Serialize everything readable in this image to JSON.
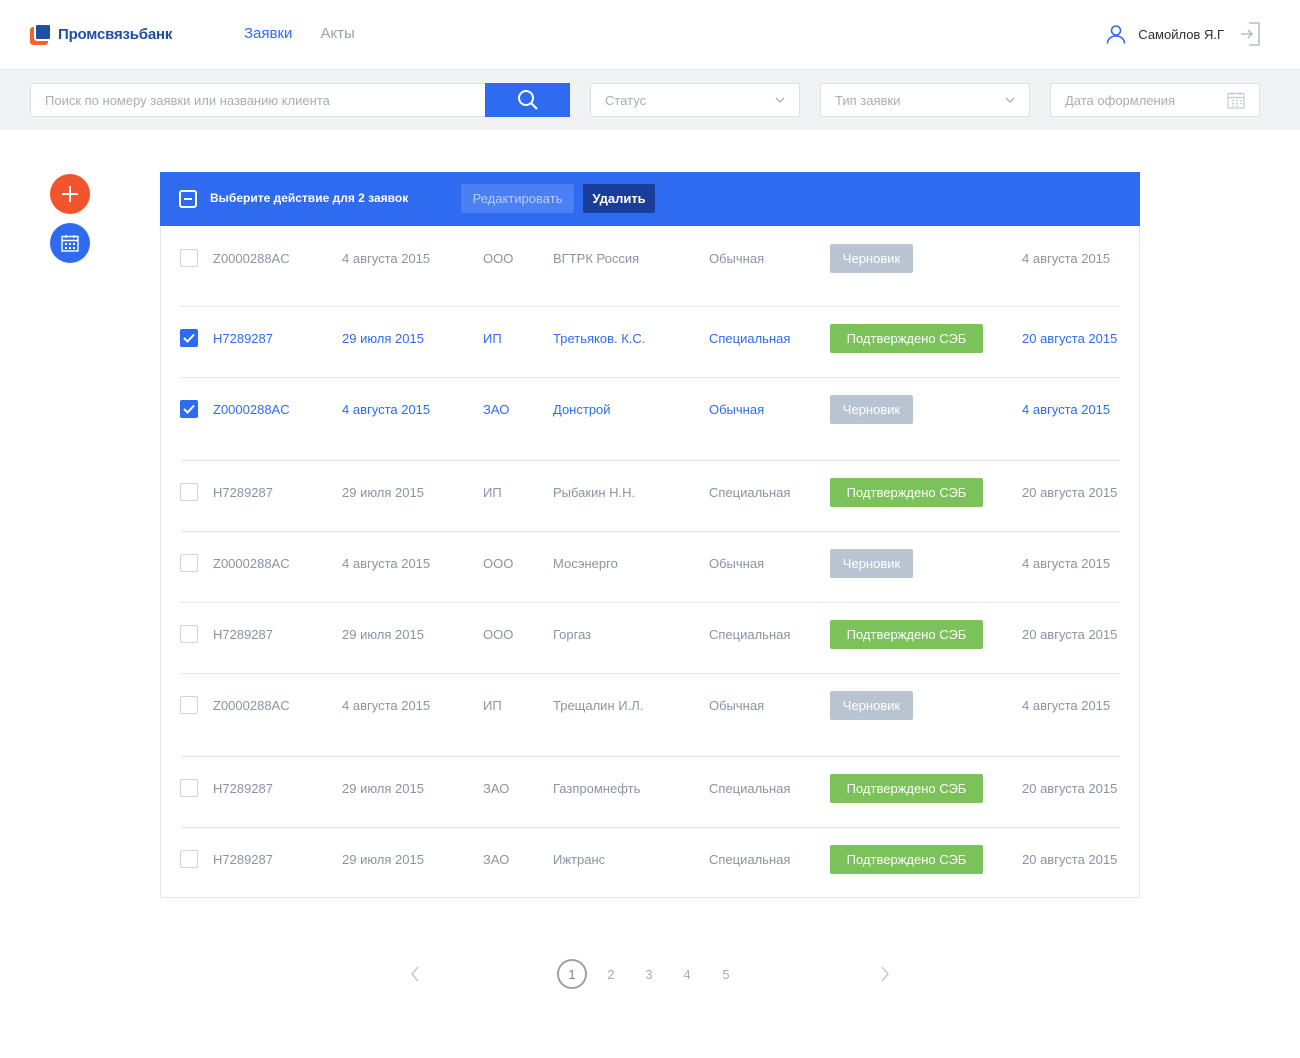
{
  "header": {
    "logo_text": "Промсвязьбанк",
    "nav": [
      {
        "label": "Заявки",
        "active": true
      },
      {
        "label": "Акты",
        "active": false
      }
    ],
    "user_name": "Самойлов Я.Г"
  },
  "filters": {
    "search_placeholder": "Поиск по номеру заявки или названию клиента",
    "status_placeholder": "Статус",
    "type_placeholder": "Тип заявки",
    "date_placeholder": "Дата оформления"
  },
  "action_bar": {
    "text": "Выберите действие для 2 заявок",
    "edit_label": "Редактировать",
    "delete_label": "Удалить"
  },
  "colors": {
    "accent": "#2f6bf0",
    "add_button": "#f2542d",
    "draft_badge": "#b9c4d3",
    "confirmed_badge": "#7bc25a",
    "delete_button": "#1a3d99"
  },
  "rows": [
    {
      "id": "Z0000288AC",
      "date": "4 августа 2015",
      "form": "ООО",
      "client": "ВГТРК Россия",
      "type": "Обычная",
      "status": "Черновик",
      "status_kind": "draft",
      "end_date": "4 августа 2015",
      "selected": false
    },
    {
      "id": "H7289287",
      "date": "29 июля 2015",
      "form": "ИП",
      "client": "Третьяков. К.С.",
      "type": "Специальная",
      "status": "Подтверждено СЭБ",
      "status_kind": "ok",
      "end_date": "20 августа 2015",
      "selected": true
    },
    {
      "id": "Z0000288AC",
      "date": "4 августа 2015",
      "form": "ЗАО",
      "client": "Донстрой",
      "type": "Обычная",
      "status": "Черновик",
      "status_kind": "draft",
      "end_date": "4 августа 2015",
      "selected": true
    },
    {
      "id": "H7289287",
      "date": "29 июля 2015",
      "form": "ИП",
      "client": "Рыбакин Н.Н.",
      "type": "Специальная",
      "status": "Подтверждено СЭБ",
      "status_kind": "ok",
      "end_date": "20 августа 2015",
      "selected": false
    },
    {
      "id": "Z0000288AC",
      "date": "4 августа 2015",
      "form": "ООО",
      "client": "Мосэнерго",
      "type": "Обычная",
      "status": "Черновик",
      "status_kind": "draft",
      "end_date": "4 августа 2015",
      "selected": false
    },
    {
      "id": "H7289287",
      "date": "29 июля 2015",
      "form": "ООО",
      "client": "Горгаз",
      "type": "Специальная",
      "status": "Подтверждено СЭБ",
      "status_kind": "ok",
      "end_date": "20 августа 2015",
      "selected": false
    },
    {
      "id": "Z0000288AC",
      "date": "4 августа 2015",
      "form": "ИП",
      "client": "Трещалин И.Л.",
      "type": "Обычная",
      "status": "Черновик",
      "status_kind": "draft",
      "end_date": "4 августа 2015",
      "selected": false
    },
    {
      "id": "H7289287",
      "date": "29 июля 2015",
      "form": "ЗАО",
      "client": "Газпромнефть",
      "type": "Специальная",
      "status": "Подтверждено СЭБ",
      "status_kind": "ok",
      "end_date": "20 августа 2015",
      "selected": false
    },
    {
      "id": "H7289287",
      "date": "29 июля 2015",
      "form": "ЗАО",
      "client": "Ижтранс",
      "type": "Специальная",
      "status": "Подтверждено СЭБ",
      "status_kind": "ok",
      "end_date": "20 августа 2015",
      "selected": false
    }
  ],
  "pagination": {
    "pages": [
      "1",
      "2",
      "3",
      "4",
      "5"
    ],
    "current": "1"
  }
}
